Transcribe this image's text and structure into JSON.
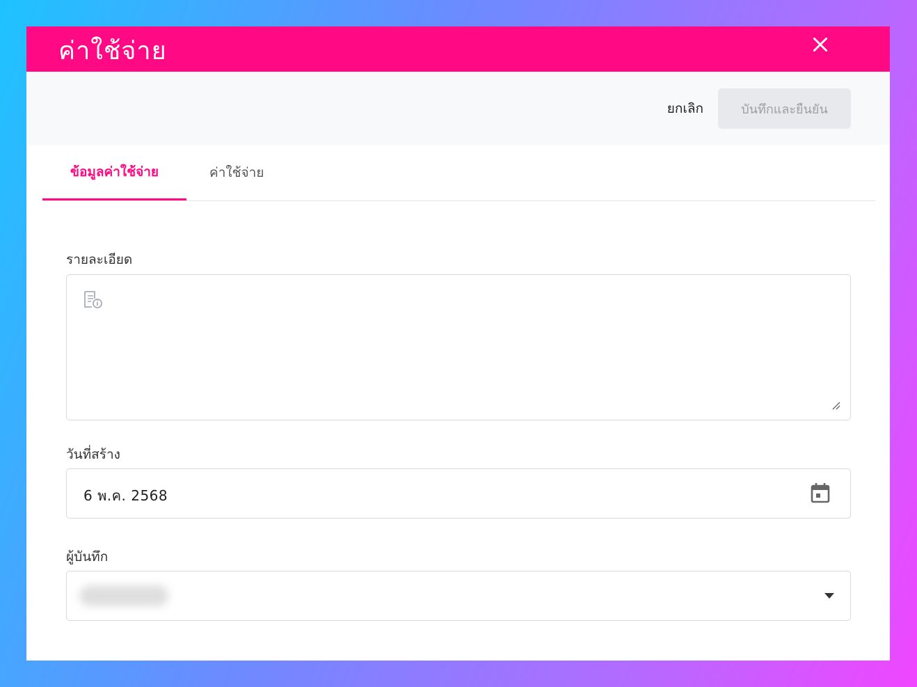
{
  "modal": {
    "title": "ค่าใช้จ่าย",
    "accent_color": "#ff0a84"
  },
  "toolbar": {
    "cancel_label": "ยกเลิก",
    "save_label": "บันทึกและยืนยัน"
  },
  "tabs": [
    {
      "label": "ข้อมูลค่าใช้จ่าย",
      "active": true
    },
    {
      "label": "ค่าใช้จ่าย",
      "active": false
    }
  ],
  "form": {
    "details": {
      "label": "รายละเอียด",
      "value": ""
    },
    "created_date": {
      "label": "วันที่สร้าง",
      "value": "6 พ.ค. 2568"
    },
    "recorder": {
      "label": "ผู้บันทึก"
    }
  },
  "icons": {
    "close": "close-icon",
    "document": "document-info-icon",
    "resize": "resize-handle-icon",
    "calendar": "calendar-icon",
    "dropdown": "caret-down-icon"
  }
}
